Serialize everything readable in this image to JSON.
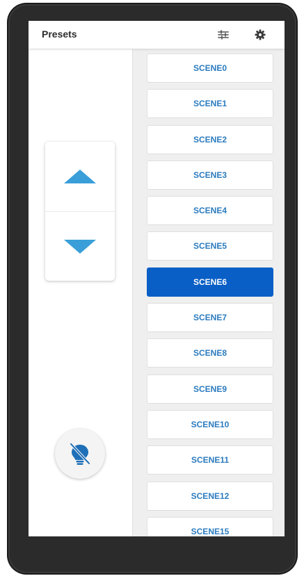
{
  "header": {
    "title": "Presets",
    "icons": [
      "sliders-icon",
      "gear-icon"
    ]
  },
  "colors": {
    "accent": "#0a5fc6",
    "scene_text": "#2b7bbf",
    "arrow": "#3a9fd9",
    "frame": "#2b2b2b"
  },
  "controls": {
    "up_icon": "triangle-up-icon",
    "down_icon": "triangle-down-icon",
    "light_icon": "lightbulb-off-icon"
  },
  "scenes": {
    "selected": "SCENE6",
    "items": [
      "SCENE0",
      "SCENE1",
      "SCENE2",
      "SCENE3",
      "SCENE4",
      "SCENE5",
      "SCENE6",
      "SCENE7",
      "SCENE8",
      "SCENE9",
      "SCENE10",
      "SCENE11",
      "SCENE12",
      "SCENE15"
    ]
  }
}
